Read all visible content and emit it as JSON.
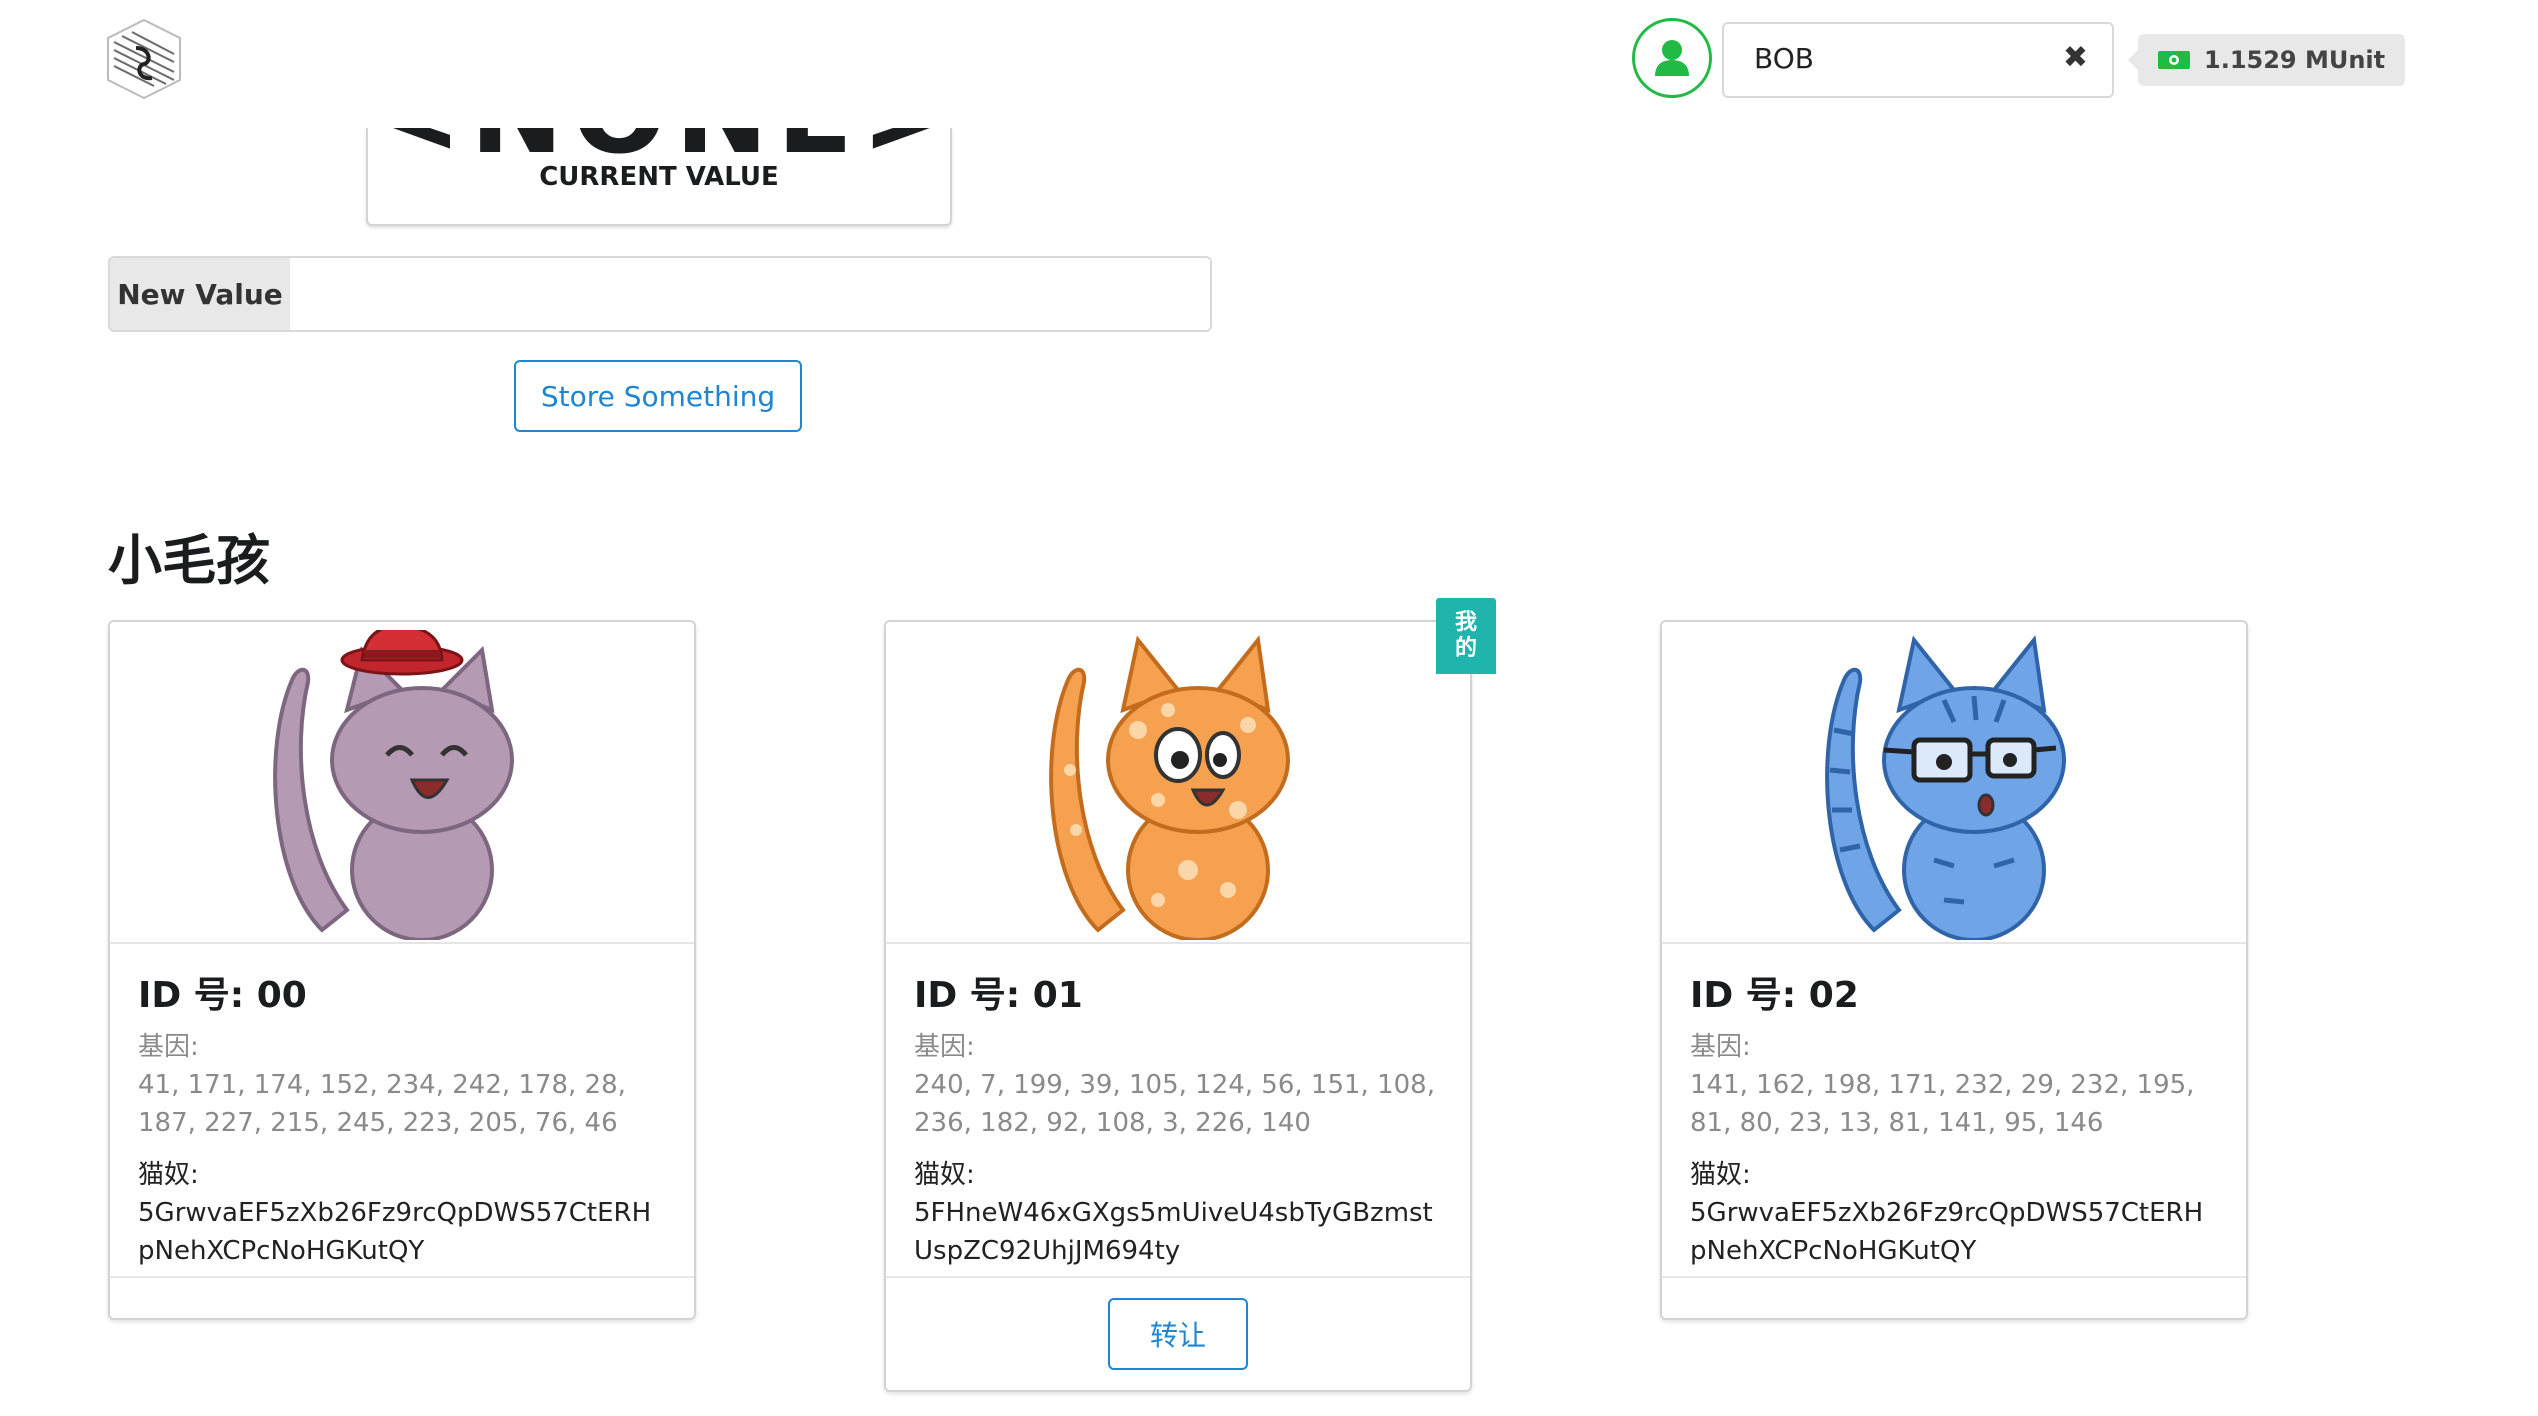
{
  "header": {
    "account_name": "BOB",
    "balance": "1.1529 MUnit",
    "icons": {
      "logo": "logo-icon",
      "avatar": "user-icon",
      "clear": "close-icon",
      "balance": "money-icon"
    }
  },
  "value_panel": {
    "current_value": "<NONE>",
    "current_value_label": "CURRENT VALUE",
    "new_value_label": "New Value",
    "new_value_input": "",
    "store_button": "Store Something"
  },
  "kitties_section": {
    "title": "小毛孩",
    "mine_badge": [
      "我",
      "的"
    ],
    "transfer_button": "转让",
    "kitties": [
      {
        "title": "ID 号: 00",
        "dna_label": "基因:",
        "dna": "41, 171, 174, 152, 234, 242, 178, 28, 187, 227, 215, 245, 223, 205, 76, 46",
        "owner_label": "猫奴:",
        "owner": "5GrwvaEF5zXb26Fz9rcQpDWS57CtERHpNehXCPcNoHGKutQY",
        "body_color": "#b59ab3",
        "accessory": "red-hat"
      },
      {
        "title": "ID 号: 01",
        "dna_label": "基因:",
        "dna": "240, 7, 199, 39, 105, 124, 56, 151, 108, 236, 182, 92, 108, 3, 226, 140",
        "owner_label": "猫奴:",
        "owner": "5FHneW46xGXgs5mUiveU4sbTyGBzmstUspZC92UhjJM694ty",
        "body_color": "#f5a150",
        "accessory": "spots"
      },
      {
        "title": "ID 号: 02",
        "dna_label": "基因:",
        "dna": "141, 162, 198, 171, 232, 29, 232, 195, 81, 80, 23, 13, 81, 141, 95, 146",
        "owner_label": "猫奴:",
        "owner": "5GrwvaEF5zXb26Fz9rcQpDWS57CtERHpNehXCPcNoHGKutQY",
        "body_color": "#6fa5e6",
        "accessory": "glasses"
      }
    ]
  }
}
